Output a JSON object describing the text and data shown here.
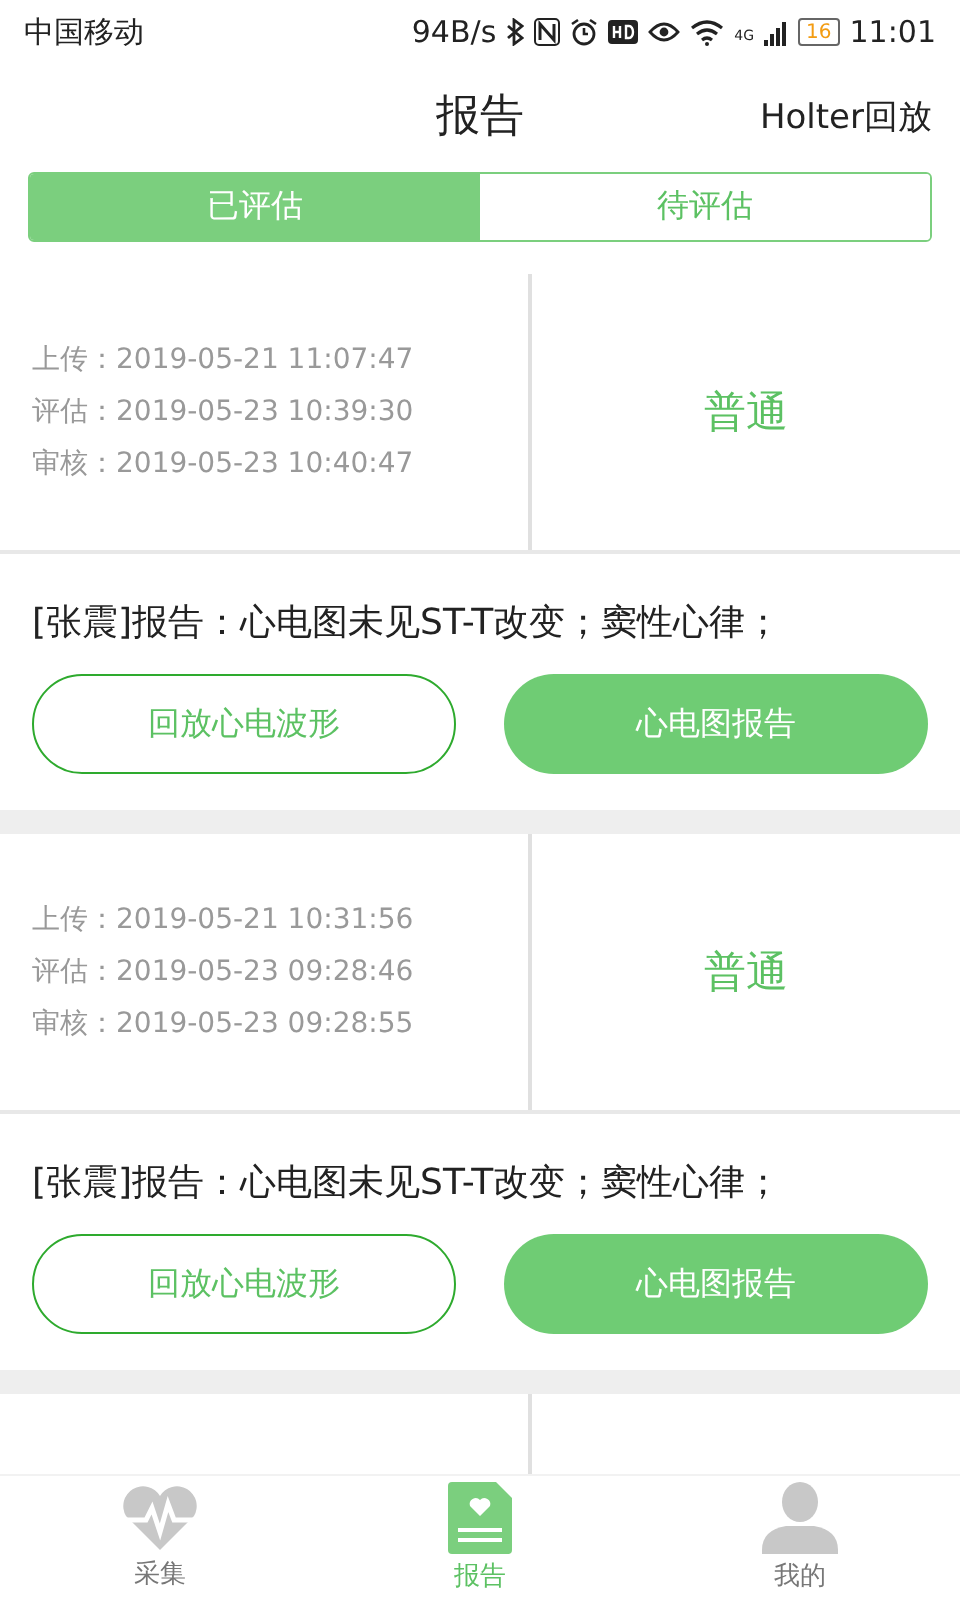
{
  "status_bar": {
    "carrier": "中国移动",
    "speed": "94B/s",
    "network": "4G",
    "battery": "16",
    "time": "11:01"
  },
  "header": {
    "title": "报告",
    "action": "Holter回放"
  },
  "tabs": [
    {
      "label": "已评估",
      "selected": true
    },
    {
      "label": "待评估",
      "selected": false
    }
  ],
  "reports": [
    {
      "lines": [
        {
          "label": "上传：",
          "value": "2019-05-21 11:07:47"
        },
        {
          "label": "评估：",
          "value": "2019-05-23 10:39:30"
        },
        {
          "label": "审核：",
          "value": "2019-05-23 10:40:47"
        }
      ],
      "grade": "普通",
      "summary": "[张震]报告：心电图未见ST-T改变；窦性心律；",
      "buttons": [
        {
          "label": "回放心电波形",
          "kind": "outline"
        },
        {
          "label": "心电图报告",
          "kind": "filled"
        }
      ]
    },
    {
      "lines": [
        {
          "label": "上传：",
          "value": "2019-05-21 10:31:56"
        },
        {
          "label": "评估：",
          "value": "2019-05-23 09:28:46"
        },
        {
          "label": "审核：",
          "value": "2019-05-23 09:28:55"
        }
      ],
      "grade": "普通",
      "summary": "[张震]报告：心电图未见ST-T改变；窦性心律；",
      "buttons": [
        {
          "label": "回放心电波形",
          "kind": "outline"
        },
        {
          "label": "心电图报告",
          "kind": "filled"
        }
      ]
    }
  ],
  "nav": [
    {
      "label": "采集",
      "kind": "heart",
      "selected": false
    },
    {
      "label": "报告",
      "kind": "report",
      "selected": true
    },
    {
      "label": "我的",
      "kind": "user",
      "selected": false
    }
  ]
}
